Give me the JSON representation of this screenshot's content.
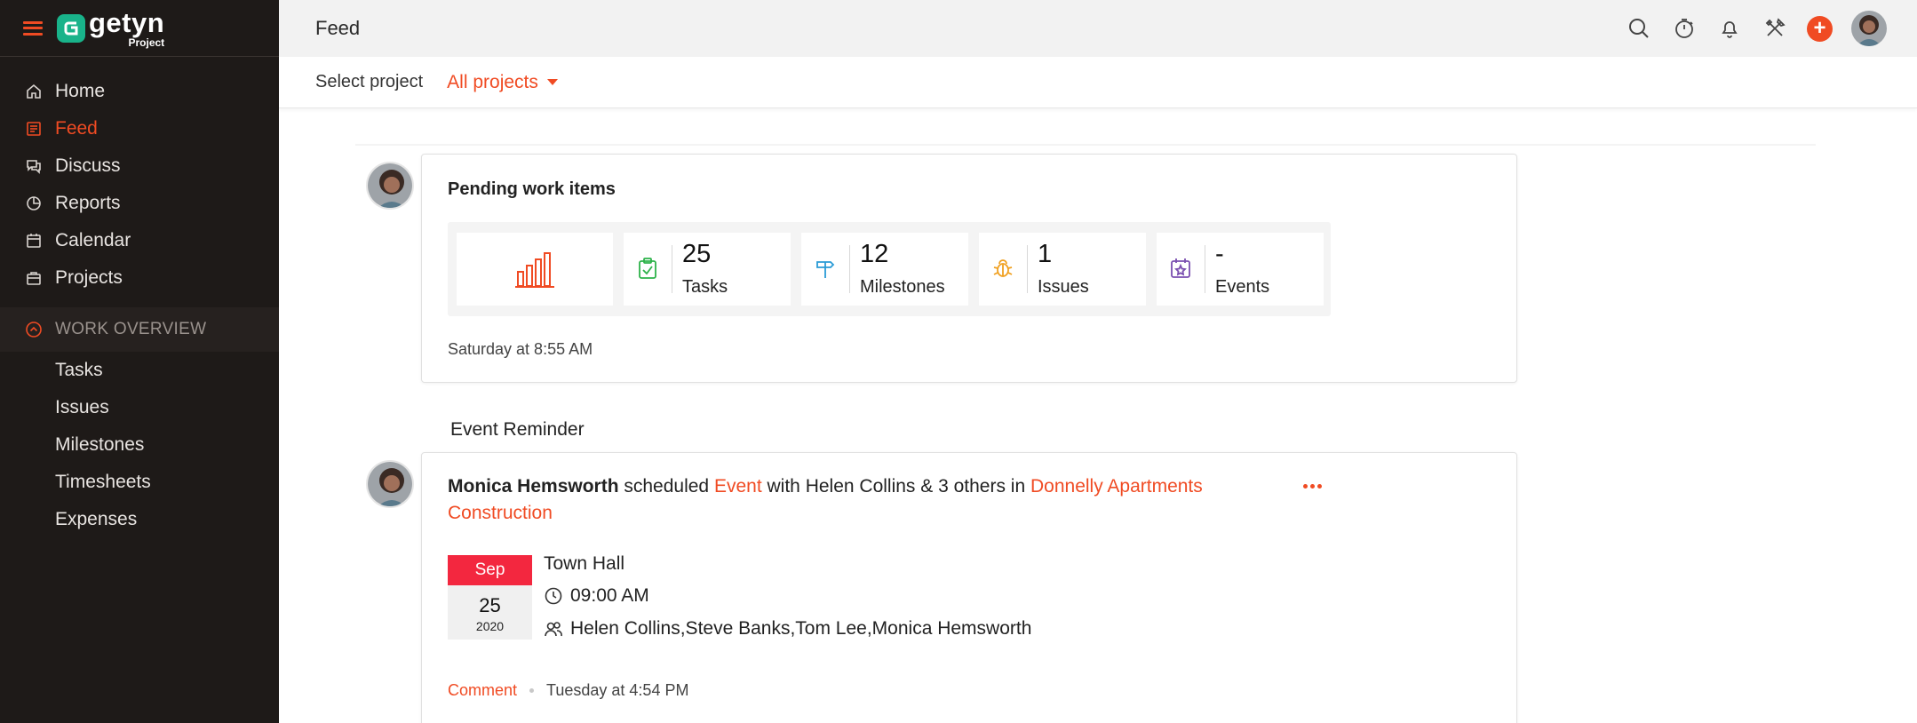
{
  "brand": {
    "name": "getyn",
    "sub": "Project"
  },
  "sidebar": {
    "items": [
      {
        "label": "Home",
        "icon": "home-icon"
      },
      {
        "label": "Feed",
        "icon": "feed-icon",
        "active": true
      },
      {
        "label": "Discuss",
        "icon": "discuss-icon"
      },
      {
        "label": "Reports",
        "icon": "reports-icon"
      },
      {
        "label": "Calendar",
        "icon": "calendar-icon"
      },
      {
        "label": "Projects",
        "icon": "projects-icon"
      }
    ],
    "section": "WORK OVERVIEW",
    "sub_items": [
      "Tasks",
      "Issues",
      "Milestones",
      "Timesheets",
      "Expenses"
    ]
  },
  "header": {
    "title": "Feed"
  },
  "project_selector": {
    "label": "Select project",
    "value": "All projects"
  },
  "pending": {
    "title": "Pending work items",
    "stats": [
      {
        "value": "25",
        "label": "Tasks",
        "icon": "task-clipboard-icon",
        "color": "#2db24a"
      },
      {
        "value": "12",
        "label": "Milestones",
        "icon": "milestone-signpost-icon",
        "color": "#2a9bd6"
      },
      {
        "value": "1",
        "label": "Issues",
        "icon": "bug-icon",
        "color": "#f0a020"
      },
      {
        "value": "-",
        "label": "Events",
        "icon": "event-calendar-icon",
        "color": "#7a4fb0"
      }
    ],
    "time": "Saturday at 8:55 AM"
  },
  "event_section_label": "Event Reminder",
  "event": {
    "user": "Monica Hemsworth",
    "text_scheduled": "scheduled",
    "type": "Event",
    "text_with": "with Helen Collins & 3 others in",
    "project": "Donnelly Apartments Construction",
    "date_month": "Sep",
    "date_day": "25",
    "date_year": "2020",
    "title": "Town Hall",
    "time": "09:00 AM",
    "attendees": "Helen Collins,Steve Banks,Tom Lee,Monica Hemsworth",
    "comment_label": "Comment",
    "posted": "Tuesday at 4:54 PM"
  },
  "colors": {
    "accent": "#f04b23",
    "sidebar_bg": "#1e1a18",
    "date_red": "#f3273f"
  }
}
